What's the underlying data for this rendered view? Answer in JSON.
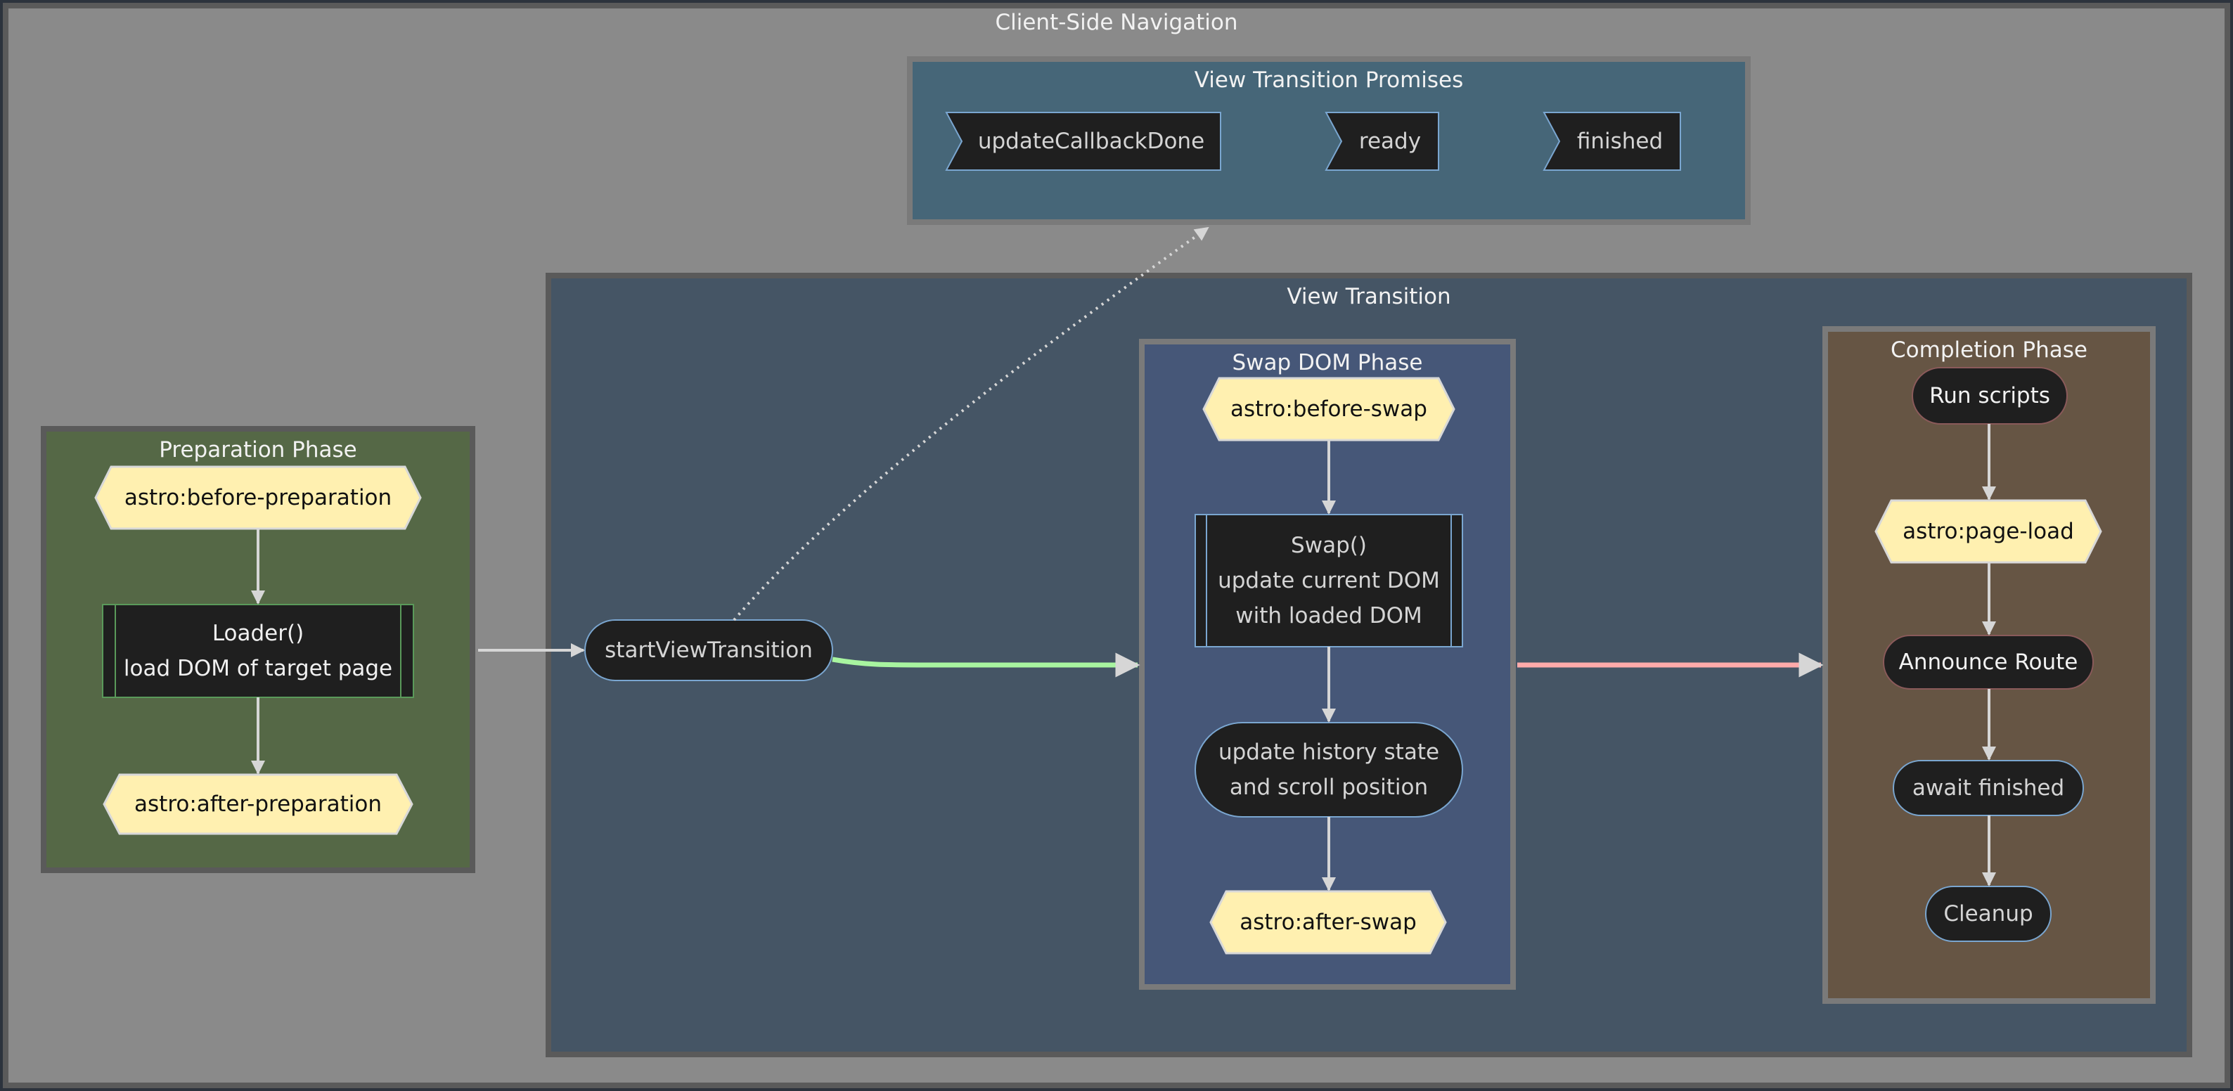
{
  "diagram": {
    "title": "Client-Side Navigation",
    "colors": {
      "canvas": "#8a8a8a",
      "frame_border": "#5a5a5a",
      "promises_fill": "#466678",
      "view_transition_fill": "#455565",
      "preparation_fill": "#556846",
      "swap_fill": "#465778",
      "completion_fill": "#665544",
      "event_fill": "#fff0b0",
      "process_fill": "#1f1f1f",
      "green_edge": "#a8f5a0",
      "red_edge": "#ffaaaa",
      "edge": "#d6d6d6"
    },
    "promises": {
      "title": "View Transition Promises",
      "items": [
        "updateCallbackDone",
        "ready",
        "finished"
      ]
    },
    "view_transition": {
      "title": "View Transition",
      "start_node": "startViewTransition"
    },
    "preparation": {
      "title": "Preparation Phase",
      "event_before": "astro:before-preparation",
      "loader_line1": "Loader()",
      "loader_line2": "load DOM of target page",
      "event_after": "astro:after-preparation"
    },
    "swap": {
      "title": "Swap DOM Phase",
      "event_before": "astro:before-swap",
      "swap_line1": "Swap()",
      "swap_line2": "update current DOM",
      "swap_line3": "with loaded DOM",
      "history_line1": "update history state",
      "history_line2": "and scroll position",
      "event_after": "astro:after-swap"
    },
    "completion": {
      "title": "Completion Phase",
      "run_scripts": "Run scripts",
      "event_page_load": "astro:page-load",
      "announce_route": "Announce Route",
      "await_finished": "await finished",
      "cleanup": "Cleanup"
    },
    "edges": [
      {
        "from": "preparation",
        "to": "startViewTransition",
        "style": "solid"
      },
      {
        "from": "startViewTransition",
        "to": "promises",
        "style": "dotted"
      },
      {
        "from": "startViewTransition",
        "to": "swap",
        "style": "thick-green"
      },
      {
        "from": "swap",
        "to": "completion",
        "style": "thick-red"
      },
      {
        "from": "astro:before-preparation",
        "to": "Loader()",
        "style": "solid"
      },
      {
        "from": "Loader()",
        "to": "astro:after-preparation",
        "style": "solid"
      },
      {
        "from": "astro:before-swap",
        "to": "Swap()",
        "style": "solid"
      },
      {
        "from": "Swap()",
        "to": "update history state",
        "style": "solid"
      },
      {
        "from": "update history state",
        "to": "astro:after-swap",
        "style": "solid"
      },
      {
        "from": "Run scripts",
        "to": "astro:page-load",
        "style": "solid"
      },
      {
        "from": "astro:page-load",
        "to": "Announce Route",
        "style": "solid"
      },
      {
        "from": "Announce Route",
        "to": "await finished",
        "style": "solid"
      },
      {
        "from": "await finished",
        "to": "Cleanup",
        "style": "solid"
      }
    ]
  }
}
